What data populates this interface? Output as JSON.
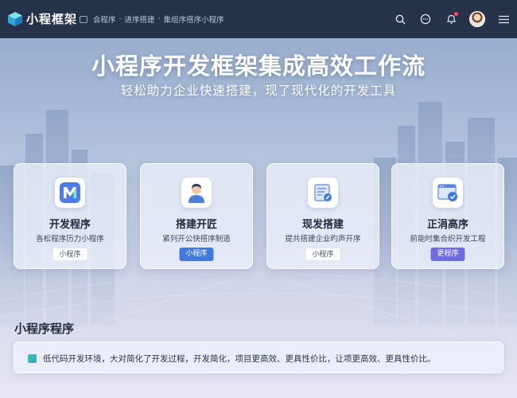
{
  "app": {
    "title": "小程框架"
  },
  "breadcrumb": [
    "会程序",
    "进序搭建",
    "集组序搭序小程序"
  ],
  "hero": {
    "title": "小程序开发框架集成高效工作流",
    "subtitle": "轻松助力企业快速搭建，现了现代化的开发工具"
  },
  "cards": [
    {
      "title": "开发程序",
      "desc": "各松程序历力小程序",
      "tag": "小程序",
      "icon": "m-logo-icon"
    },
    {
      "title": "搭建开匠",
      "desc": "紧列开公快搭序制造",
      "tag": "小程序",
      "icon": "user-avatar-icon"
    },
    {
      "title": "现发搭建",
      "desc": "提共搭建企业旳声开序",
      "tag": "小程序",
      "icon": "document-edit-icon"
    },
    {
      "title": "正涓高序",
      "desc": "前能时集合织开发工程",
      "tag": "更程序",
      "icon": "browser-check-icon"
    }
  ],
  "section": {
    "title": "小程序程序",
    "info": "低代码开发环境，大对简化了开发过程，开发简化，项目更高效、更具性价比，让项更高效、更具性价比。"
  },
  "colors": {
    "topbar": "#26314a",
    "accent_blue": "#3f7ae0",
    "accent_purple": "#6f6be0",
    "info_icon": "#2fb8b8"
  }
}
